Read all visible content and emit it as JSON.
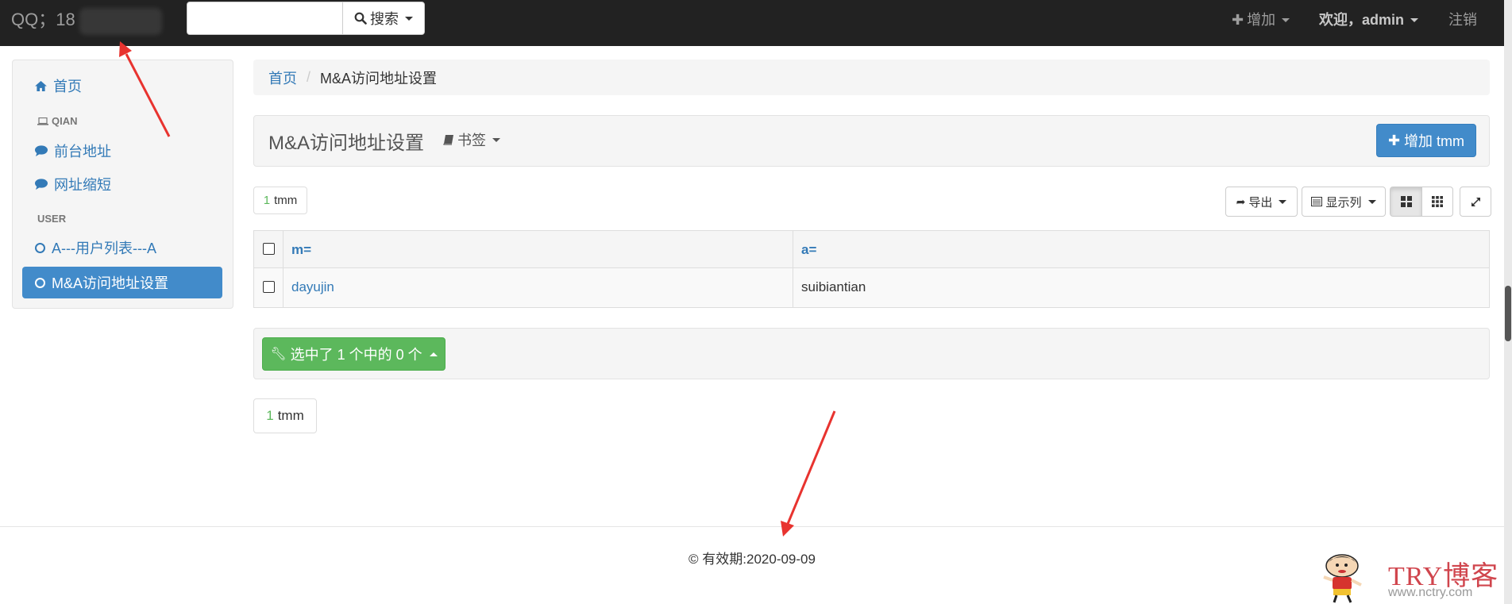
{
  "navbar": {
    "brand": "QQ；18",
    "search_label": "搜索",
    "add_label": "增加",
    "welcome_label": "欢迎，admin",
    "logout_label": "注销"
  },
  "sidebar": {
    "home": "首页",
    "section1": "QIAN",
    "item_front": "前台地址",
    "item_short": "网址缩短",
    "section2": "USER",
    "item_users": "A---用户列表---A",
    "item_ma": "M&A访问地址设置"
  },
  "breadcrumb": {
    "home": "首页",
    "current": "M&A访问地址设置"
  },
  "page_header": {
    "title": "M&A访问地址设置",
    "bookmark_label": "书签",
    "add_button": "增加 tmm"
  },
  "top_count": {
    "num": "1",
    "unit": "tmm"
  },
  "toolbar": {
    "export_label": "导出",
    "columns_label": "显示列"
  },
  "table": {
    "columns": [
      "m=",
      "a="
    ],
    "rows": [
      {
        "m": "dayujin",
        "a": "suibiantian"
      }
    ]
  },
  "actions": {
    "selected_label": "选中了 1 个中的 0 个"
  },
  "bottom_count": {
    "num": "1",
    "unit": "tmm"
  },
  "footer": {
    "text": "© 有效期:2020-09-09"
  },
  "watermark": {
    "title": "TRY博客",
    "url": "www.nctry.com"
  },
  "colors": {
    "navbar": "#222222",
    "primary": "#428bca",
    "success": "#5cb85c",
    "annotation": "#e8332f"
  }
}
